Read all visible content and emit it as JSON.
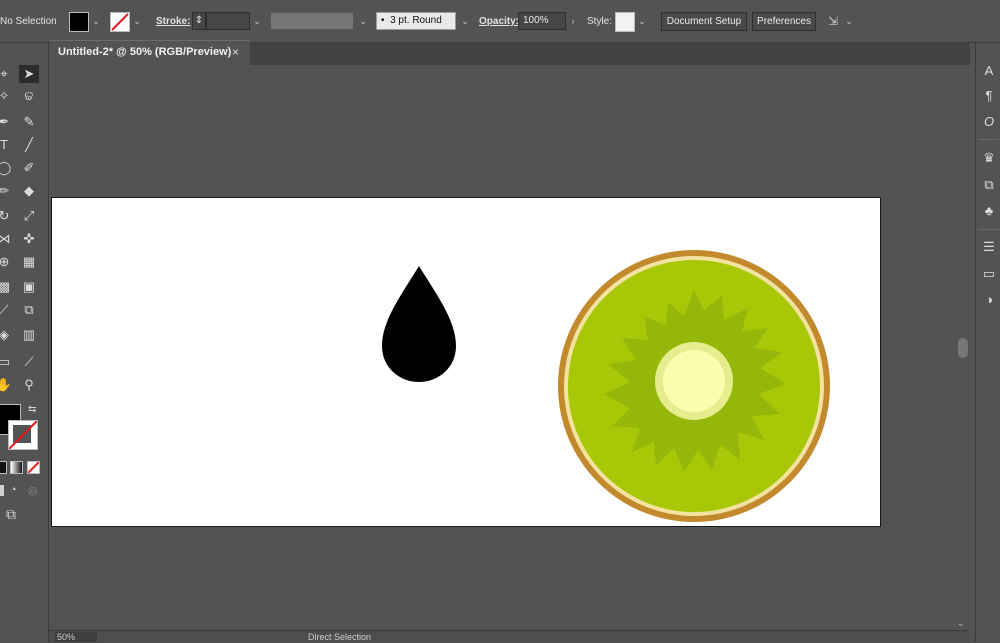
{
  "control_bar": {
    "selection_label": "No Selection",
    "fill_color": "#000000",
    "stroke_label": "Stroke:",
    "stroke_weight": "",
    "brush_value": "3 pt. Round",
    "opacity_label": "Opacity:",
    "opacity_value": "100%",
    "style_label": "Style:",
    "document_setup_label": "Document Setup",
    "preferences_label": "Preferences"
  },
  "document_tab": {
    "title": "Untitled-2* @ 50% (RGB/Preview)",
    "close_glyph": "×"
  },
  "artwork": {
    "drop_color": "#000000",
    "kiwi_rim_color": "#c28a2c",
    "kiwi_inner_rim_color": "#f3e3a0",
    "kiwi_flesh_color": "#a8c707",
    "kiwi_seed_halo_color": "#95b70a",
    "kiwi_core_ring_color": "#e5ed8e",
    "kiwi_core_color": "#fdfdb0"
  },
  "status_bar": {
    "zoom": "50%",
    "current_tool": "Direct Selection"
  },
  "toolbar_icons": [
    "direct-selection",
    "lasso",
    "pen",
    "type",
    "line",
    "ellipse",
    "paintbrush",
    "eraser",
    "rotate",
    "scale",
    "width",
    "free-transform",
    "shape-builder",
    "perspective-grid",
    "mesh",
    "gradient",
    "eyedropper",
    "blend",
    "symbol-sprayer",
    "column-graph",
    "artboard",
    "slice",
    "hand",
    "zoom"
  ],
  "dock_icons": [
    "character",
    "paragraph",
    "opentype",
    "puppet-warp",
    "transform",
    "symbols",
    "stroke",
    "gradient",
    "transparency"
  ]
}
